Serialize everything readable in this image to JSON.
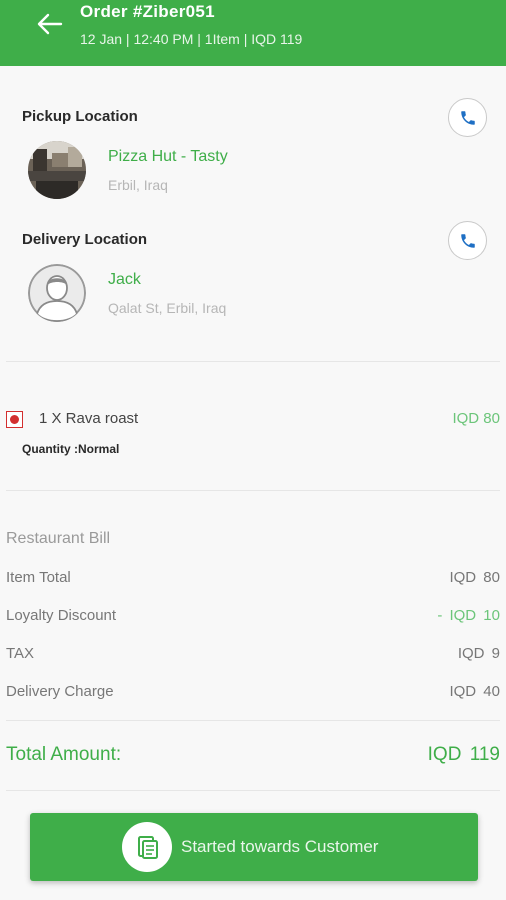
{
  "header": {
    "title": "Order #Ziber051",
    "meta": "12 Jan | 12:40 PM | 1Item | IQD  119",
    "back_icon": "arrow-left-icon"
  },
  "pickup": {
    "label": "Pickup Location",
    "name": "Pizza Hut - Tasty",
    "address": "Erbil, Iraq",
    "call_icon": "phone-icon"
  },
  "delivery": {
    "label": "Delivery Location",
    "name": "Jack",
    "address": "Qalat St, Erbil, Iraq",
    "call_icon": "phone-icon"
  },
  "item": {
    "name": "1 X Rava roast",
    "price": "IQD 80",
    "quantity": "Quantity :Normal",
    "veg_color": "#d32f2f"
  },
  "bill": {
    "title": "Restaurant Bill",
    "rows": [
      {
        "label": "Item Total",
        "value": "IQD  80"
      },
      {
        "label": "Loyalty Discount",
        "value": "- IQD  10"
      },
      {
        "label": "TAX",
        "value": "IQD  9"
      },
      {
        "label": "Delivery Charge",
        "value": "IQD  40"
      }
    ],
    "total_label": "Total Amount:",
    "total_value": "IQD  119"
  },
  "action": {
    "label": "Started towards Customer",
    "icon": "receipt-icon"
  },
  "colors": {
    "accent": "#3fae49",
    "call_icon": "#1e6fc4"
  }
}
